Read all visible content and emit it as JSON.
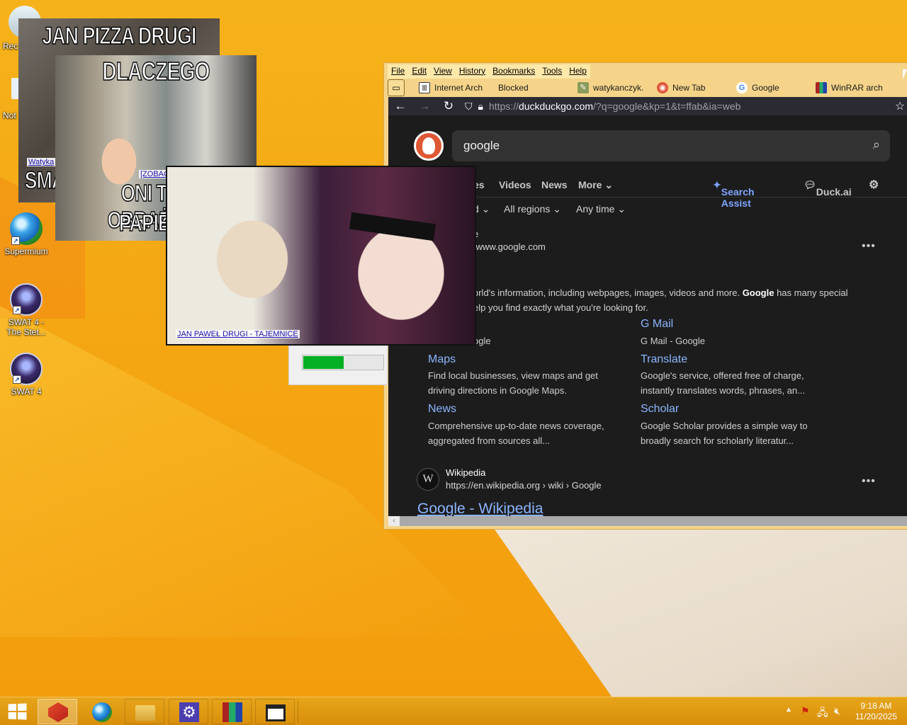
{
  "desktop_icons": [
    {
      "label": "Rec",
      "icon": "recycle-bin-icon"
    },
    {
      "label": "Not",
      "icon": "notepad-icon"
    },
    {
      "label": "Supermium",
      "icon": "supermium-browser-icon"
    },
    {
      "label": "SWAT 4 - The Stet...",
      "icon": "swat4-icon"
    },
    {
      "label": "SWAT 4",
      "icon": "swat4-icon"
    }
  ],
  "popups": {
    "popup1": {
      "headline": "JAN PIZZA DRUGI",
      "partial_text": "SMA",
      "link": "Watyka"
    },
    "popup2": {
      "headline_top": "DLACZEGO",
      "headline_bottom_1": "ONI TAK OBRAŻAJĄ",
      "headline_bottom_2": "PAPIEŻA",
      "link": "[ZOBACZ]"
    },
    "popup3": {
      "link": "JAN PAWEŁ DRUGI - TAJEMNICE"
    },
    "progress": {
      "value": 0.5
    }
  },
  "browser": {
    "menu": [
      "File",
      "Edit",
      "View",
      "History",
      "Bookmarks",
      "Tools",
      "Help"
    ],
    "tabs": [
      {
        "label": "Internet Arch",
        "icon": "archive-icon"
      },
      {
        "label": "Blocked",
        "icon": ""
      },
      {
        "label": "watykanczyk.",
        "icon": "site-favicon"
      },
      {
        "label": "New Tab",
        "icon": "firefox-icon"
      },
      {
        "label": "Google",
        "icon": "google-icon"
      },
      {
        "label": "WinRAR arch",
        "icon": "winrar-icon"
      }
    ],
    "url": {
      "prefix": "https://",
      "domain": "duckduckgo.com",
      "path": "/?q=google&kp=1&t=ffab&ia=web"
    },
    "search": {
      "query": "google"
    },
    "nav_tabs": [
      "es",
      "Videos",
      "News",
      "More ⌄"
    ],
    "search_assist": "Search Assist",
    "duck_ai": "Duck.ai",
    "filters": [
      "d ⌄",
      "All regions ⌄",
      "Any time ⌄"
    ],
    "result1": {
      "site_fragment": "e",
      "url": "/www.google.com",
      "snippet_1_pre": "orld's information, including webpages, images, videos and more. ",
      "snippet_1_bold": "Google",
      "snippet_1_post": " has many special",
      "snippet_2": "elp you find exactly what you're looking for.",
      "left_fragment": "ogle",
      "sitelinks": [
        {
          "title": "G Mail",
          "desc": "G Mail - Google"
        },
        {
          "title": "Maps",
          "desc": "Find local businesses, view maps and get driving directions in Google Maps."
        },
        {
          "title": "Translate",
          "desc": "Google's service, offered free of charge, instantly translates words, phrases, an..."
        },
        {
          "title": "News",
          "desc": "Comprehensive up-to-date news coverage, aggregated from sources all..."
        },
        {
          "title": "Scholar",
          "desc": "Google Scholar provides a simple way to broadly search for scholarly literatur..."
        }
      ]
    },
    "result2": {
      "site": "Wikipedia",
      "badge": "W",
      "url": "https://en.wikipedia.org › wiki › Google",
      "title": "Google - Wikipedia"
    }
  },
  "taskbar": {
    "items": [
      {
        "icon": "ms-office-icon",
        "active": true
      },
      {
        "icon": "supermium-icon",
        "active": false
      },
      {
        "icon": "file-explorer-icon",
        "active": false
      },
      {
        "icon": "settings-gear-icon",
        "active": false
      },
      {
        "icon": "winrar-icon",
        "active": false
      },
      {
        "icon": "window-icon",
        "active": false
      }
    ],
    "clock": {
      "time": "9:18 AM",
      "date": "11/20/2025"
    }
  }
}
